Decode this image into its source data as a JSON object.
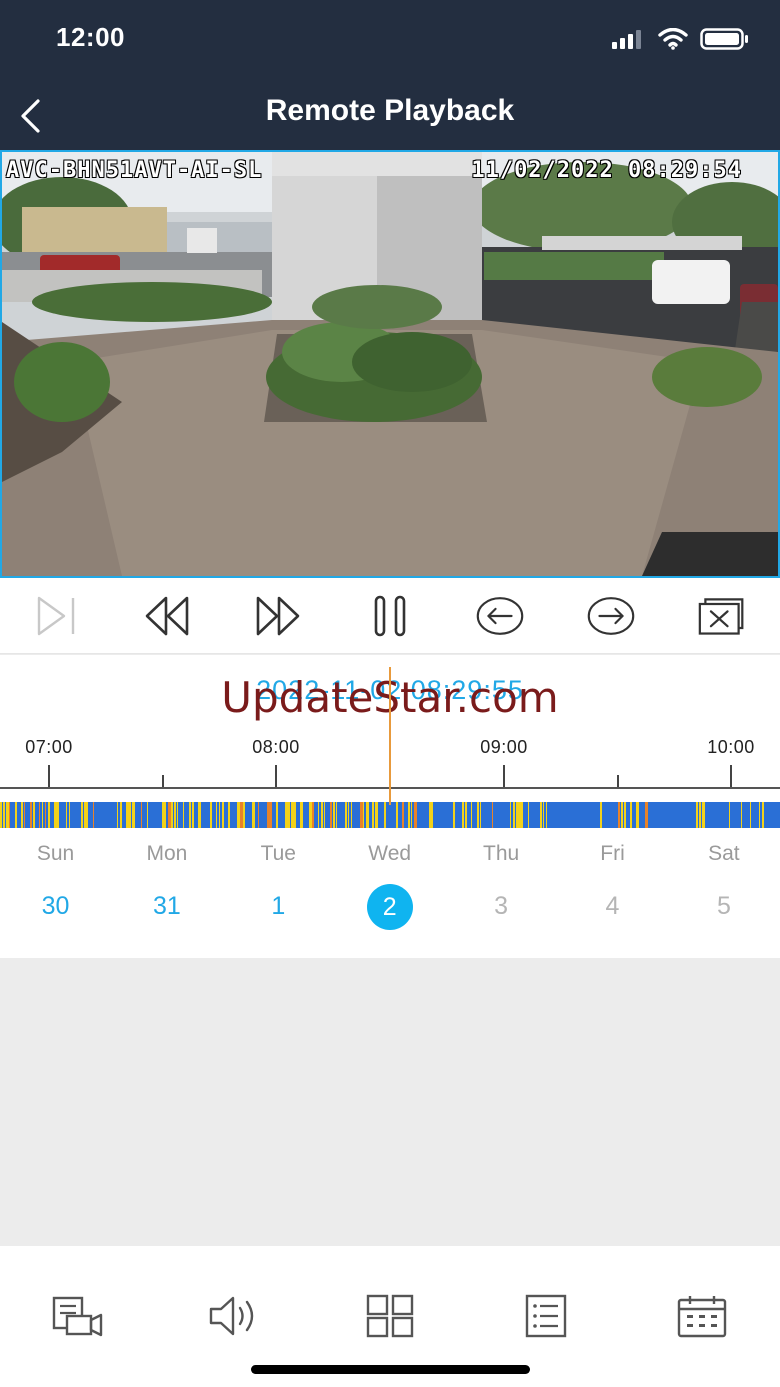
{
  "status": {
    "time": "12:00"
  },
  "header": {
    "title": "Remote Playback",
    "back_icon": "chevron-left-icon"
  },
  "video": {
    "camera_name": "AVC-BHN51AVT-AI-SL",
    "osd_datetime": "11/02/2022 08:29:54",
    "border_color": "#21a8e6"
  },
  "controls": [
    {
      "name": "next-frame-button",
      "icon": "step-forward-icon",
      "enabled": false
    },
    {
      "name": "rewind-button",
      "icon": "rewind-icon",
      "enabled": true
    },
    {
      "name": "fast-forward-button",
      "icon": "fast-forward-icon",
      "enabled": true
    },
    {
      "name": "pause-button",
      "icon": "pause-icon",
      "enabled": true
    },
    {
      "name": "previous-button",
      "icon": "arrow-left-circle-icon",
      "enabled": true
    },
    {
      "name": "next-button",
      "icon": "arrow-right-circle-icon",
      "enabled": true
    },
    {
      "name": "close-button",
      "icon": "close-box-icon",
      "enabled": true
    }
  ],
  "timeline": {
    "current_time": "2022-11-02 08:29:55",
    "watermark": "UpdateStar.com",
    "hours": [
      "07:00",
      "08:00",
      "09:00",
      "10:00"
    ],
    "colors": {
      "normal": "#2a6fd6",
      "motion": "#f2d21a",
      "alarm": "#e8832a",
      "playhead": "#e89a3c",
      "accent": "#21a8e6"
    }
  },
  "week": {
    "days": [
      {
        "name": "Sun",
        "date": "30",
        "state": "avail"
      },
      {
        "name": "Mon",
        "date": "31",
        "state": "avail"
      },
      {
        "name": "Tue",
        "date": "1",
        "state": "avail"
      },
      {
        "name": "Wed",
        "date": "2",
        "state": "sel"
      },
      {
        "name": "Thu",
        "date": "3",
        "state": "none"
      },
      {
        "name": "Fri",
        "date": "4",
        "state": "none"
      },
      {
        "name": "Sat",
        "date": "5",
        "state": "none"
      }
    ]
  },
  "bottom_bar": [
    {
      "name": "record-button",
      "icon": "record-video-icon"
    },
    {
      "name": "audio-button",
      "icon": "speaker-icon"
    },
    {
      "name": "grid-button",
      "icon": "grid-icon"
    },
    {
      "name": "list-button",
      "icon": "list-icon"
    },
    {
      "name": "calendar-button",
      "icon": "calendar-icon"
    }
  ]
}
